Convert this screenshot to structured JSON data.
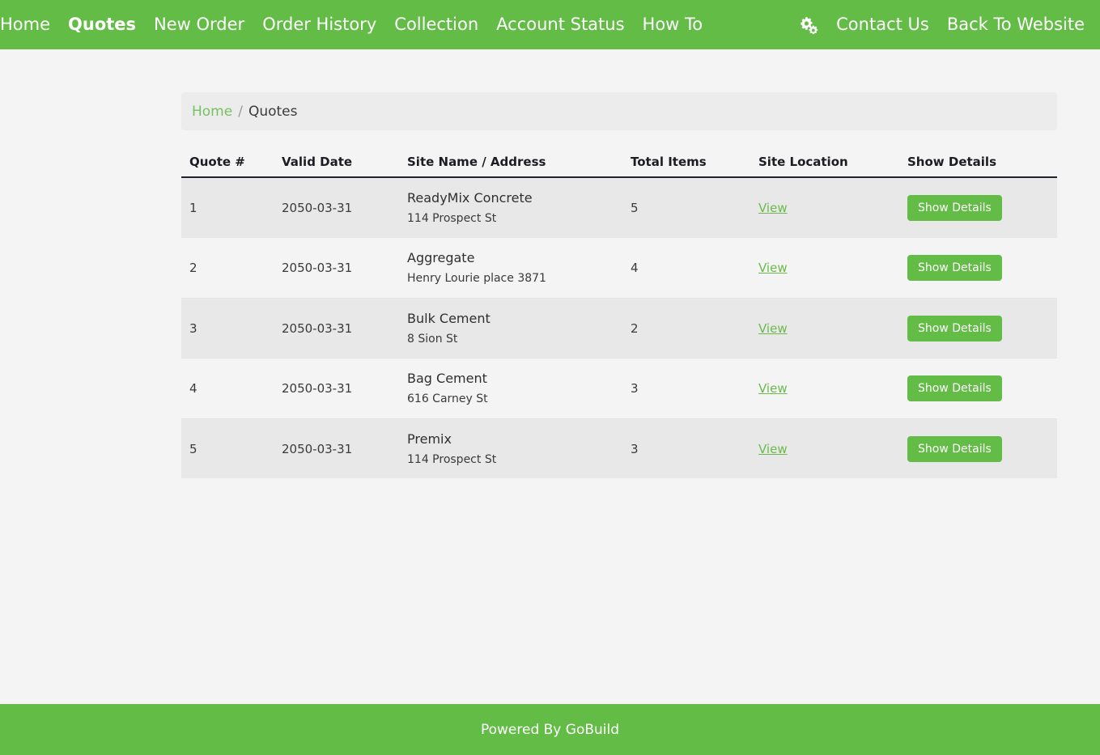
{
  "navbar": {
    "brand_color": "#63bc46",
    "left_items": [
      {
        "label": "Home",
        "active": false
      },
      {
        "label": "Quotes",
        "active": true
      },
      {
        "label": "New Order",
        "active": false
      },
      {
        "label": "Order History",
        "active": false
      },
      {
        "label": "Collection",
        "active": false
      },
      {
        "label": "Account Status",
        "active": false
      },
      {
        "label": "How To",
        "active": false
      }
    ],
    "settings_icon": "cogs-icon",
    "right_items": [
      {
        "label": "Contact Us"
      },
      {
        "label": "Back To Website"
      }
    ]
  },
  "breadcrumb": {
    "home_label": "Home",
    "separator": "/",
    "current_label": "Quotes"
  },
  "table": {
    "headers": [
      "Quote #",
      "Valid Date",
      "Site Name / Address",
      "Total Items",
      "Site Location",
      "Show Details"
    ],
    "view_link_label": "View",
    "details_button_label": "Show Details",
    "rows": [
      {
        "quote_number": "1",
        "valid_date": "2050-03-31",
        "site_name": "ReadyMix Concrete",
        "site_address": "114 Prospect St",
        "total_items": "5",
        "site_location": "View",
        "details": "Show Details"
      },
      {
        "quote_number": "2",
        "valid_date": "2050-03-31",
        "site_name": "Aggregate",
        "site_address": "Henry Lourie place 3871",
        "total_items": "4",
        "site_location": "View",
        "details": "Show Details"
      },
      {
        "quote_number": "3",
        "valid_date": "2050-03-31",
        "site_name": "Bulk Cement",
        "site_address": "8 Sion St",
        "total_items": "2",
        "site_location": "View",
        "details": "Show Details"
      },
      {
        "quote_number": "4",
        "valid_date": "2050-03-31",
        "site_name": "Bag Cement",
        "site_address": "616 Carney St",
        "total_items": "3",
        "site_location": "View",
        "details": "Show Details"
      },
      {
        "quote_number": "5",
        "valid_date": "2050-03-31",
        "site_name": "Premix",
        "site_address": "114 Prospect St",
        "total_items": "3",
        "site_location": "View",
        "details": "Show Details"
      }
    ]
  },
  "footer": {
    "text": "Powered By GoBuild"
  }
}
